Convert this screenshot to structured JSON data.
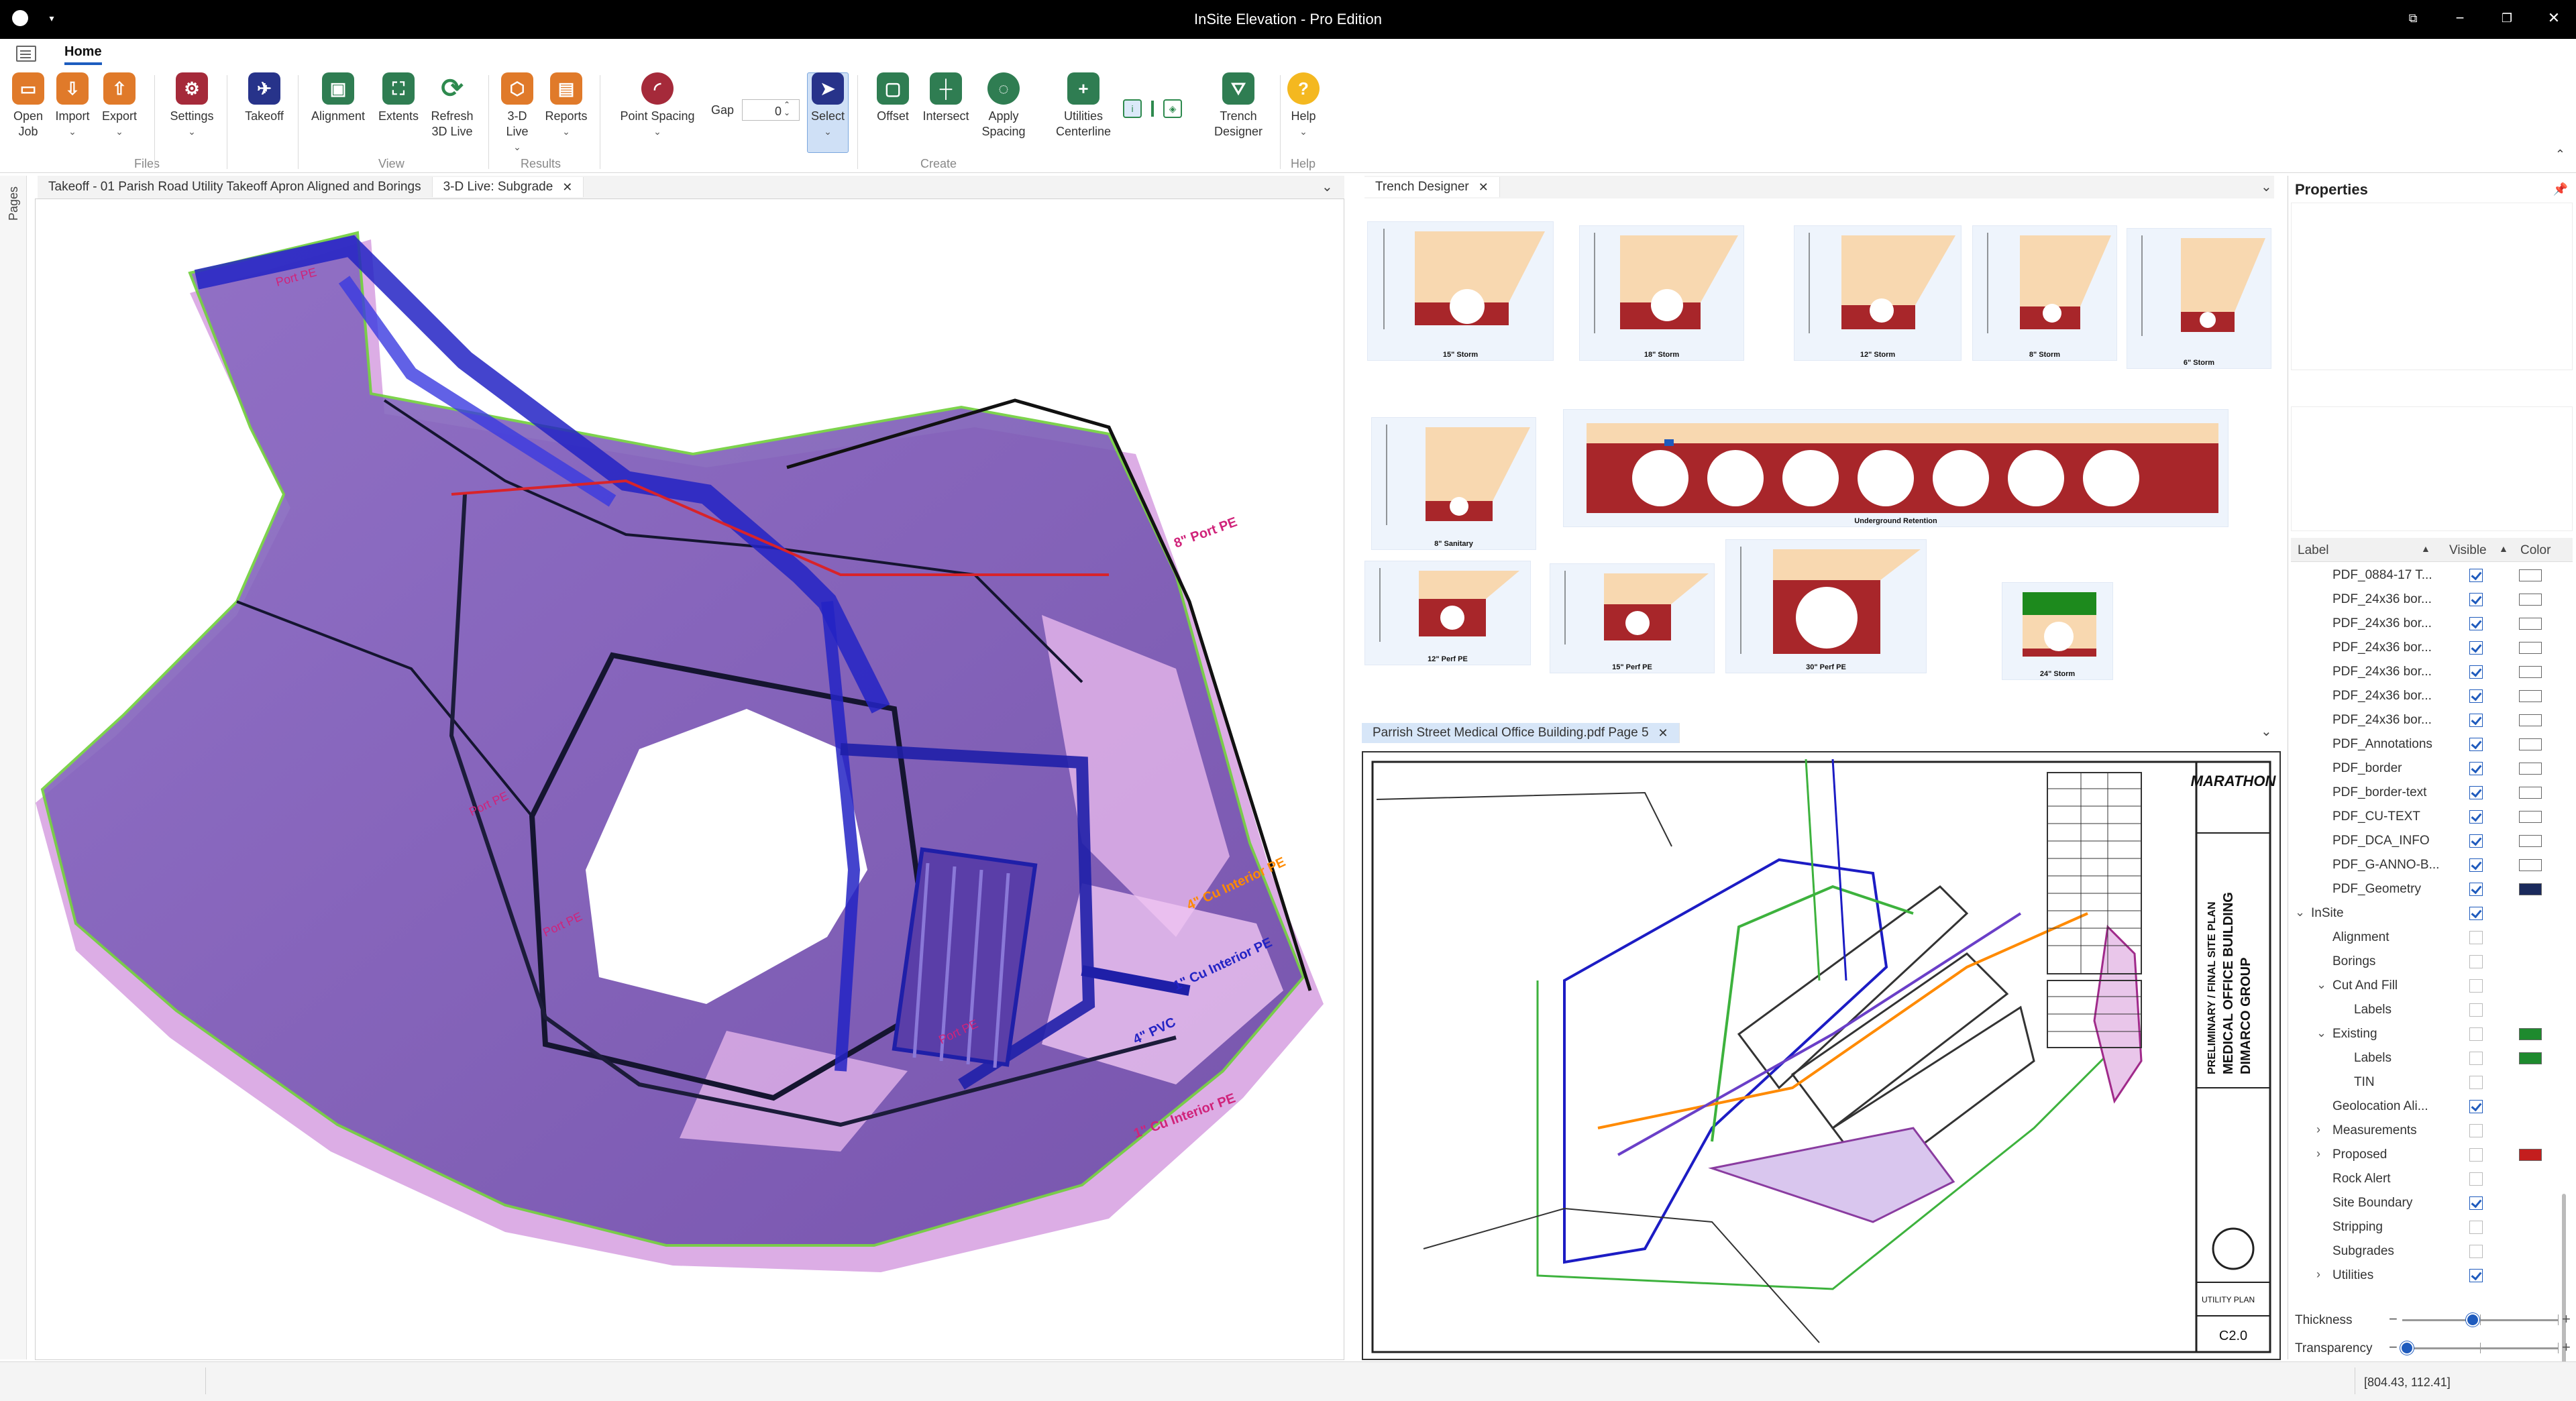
{
  "window": {
    "title": "InSite Elevation - Pro Edition"
  },
  "ribbon": {
    "active_tab": "Home",
    "buttons": {
      "open_job": "Open\nJob",
      "import": "Import",
      "export": "Export",
      "settings": "Settings",
      "takeoff": "Takeoff",
      "alignment": "Alignment",
      "extents": "Extents",
      "refresh_3d": "Refresh\n3D Live",
      "live_3d": "3-D\nLive",
      "reports": "Reports",
      "point_spacing": "Point Spacing",
      "select": "Select",
      "offset": "Offset",
      "intersect": "Intersect",
      "apply_spacing": "Apply\nSpacing",
      "utilities_centerline": "Utilities\nCenterline",
      "trench_designer": "Trench\nDesigner",
      "help": "Help"
    },
    "gap": {
      "label": "Gap",
      "value": "0"
    },
    "groups": [
      "Files",
      "View",
      "Results",
      "Create",
      "Help"
    ]
  },
  "rail": {
    "pages_label": "Pages"
  },
  "left_pane": {
    "tabs": [
      {
        "label": "Takeoff - 01 Parish Road Utility Takeoff Apron Aligned and Borings"
      },
      {
        "label": "3-D Live: Subgrade"
      }
    ],
    "labels": [
      "Port PE",
      "Port PE",
      "Port PE",
      "Port PE",
      "8\" Port PE",
      "1\" Cu Interior PE",
      "4\" Cu Interior PE",
      "4\" PVC",
      "1\" Cu Interior PE"
    ]
  },
  "trench_pane": {
    "tab": "Trench Designer",
    "cards": [
      "15\" Storm",
      "18\" Storm",
      "12\" Storm",
      "8\" Storm",
      "6\" Storm",
      "8\" Sanitary",
      "Underground Retention",
      "12\" Perf PE",
      "15\" Perf PE",
      "30\" Perf PE",
      "24\" Storm"
    ]
  },
  "pdf_pane": {
    "tab": "Parrish Street Medical Office Building.pdf Page 5",
    "sheet_title": "PRELIMINARY / FINAL SITE PLAN",
    "building": "MEDICAL OFFICE BUILDING",
    "owner": "DIMARCO GROUP",
    "sheet_name": "UTILITY PLAN",
    "sheet_no": "C2.0",
    "firm": "MARATHON"
  },
  "properties": {
    "title": "Properties",
    "columns": {
      "label": "Label",
      "visible": "Visible",
      "color": "Color"
    },
    "layers": [
      {
        "label": "PDF_0884-17 T...",
        "indent": 1,
        "visible": true,
        "color": "#ffffff"
      },
      {
        "label": "PDF_24x36 bor...",
        "indent": 1,
        "visible": true,
        "color": "#ffffff"
      },
      {
        "label": "PDF_24x36 bor...",
        "indent": 1,
        "visible": true,
        "color": "#ffffff"
      },
      {
        "label": "PDF_24x36 bor...",
        "indent": 1,
        "visible": true,
        "color": "#ffffff"
      },
      {
        "label": "PDF_24x36 bor...",
        "indent": 1,
        "visible": true,
        "color": "#ffffff"
      },
      {
        "label": "PDF_24x36 bor...",
        "indent": 1,
        "visible": true,
        "color": "#ffffff"
      },
      {
        "label": "PDF_24x36 bor...",
        "indent": 1,
        "visible": true,
        "color": "#ffffff"
      },
      {
        "label": "PDF_Annotations",
        "indent": 1,
        "visible": true,
        "color": "#ffffff"
      },
      {
        "label": "PDF_border",
        "indent": 1,
        "visible": true,
        "color": "#ffffff"
      },
      {
        "label": "PDF_border-text",
        "indent": 1,
        "visible": true,
        "color": "#ffffff"
      },
      {
        "label": "PDF_CU-TEXT",
        "indent": 1,
        "visible": true,
        "color": "#ffffff"
      },
      {
        "label": "PDF_DCA_INFO",
        "indent": 1,
        "visible": true,
        "color": "#ffffff"
      },
      {
        "label": "PDF_G-ANNO-B...",
        "indent": 1,
        "visible": true,
        "color": "#ffffff"
      },
      {
        "label": "PDF_Geometry",
        "indent": 1,
        "visible": true,
        "color": "#1a2a5c"
      },
      {
        "label": "InSite",
        "indent": 0,
        "expander": "open",
        "visible": true,
        "color": ""
      },
      {
        "label": "Alignment",
        "indent": 1,
        "visible": false,
        "color": ""
      },
      {
        "label": "Borings",
        "indent": 1,
        "visible": false,
        "color": ""
      },
      {
        "label": "Cut And Fill",
        "indent": 1,
        "expander": "open",
        "visible": false,
        "color": ""
      },
      {
        "label": "Labels",
        "indent": 2,
        "visible": false,
        "color": ""
      },
      {
        "label": "Existing",
        "indent": 1,
        "expander": "open",
        "visible": false,
        "color": "#1e8a2e"
      },
      {
        "label": "Labels",
        "indent": 2,
        "visible": false,
        "color": "#1e8a2e"
      },
      {
        "label": "TIN",
        "indent": 2,
        "visible": false,
        "color": ""
      },
      {
        "label": "Geolocation Ali...",
        "indent": 1,
        "visible": true,
        "color": ""
      },
      {
        "label": "Measurements",
        "indent": 1,
        "expander": "closed",
        "visible": false,
        "color": ""
      },
      {
        "label": "Proposed",
        "indent": 1,
        "expander": "closed",
        "visible": false,
        "color": "#c41e1e"
      },
      {
        "label": "Rock Alert",
        "indent": 1,
        "visible": false,
        "color": ""
      },
      {
        "label": "Site Boundary",
        "indent": 1,
        "visible": true,
        "color": ""
      },
      {
        "label": "Stripping",
        "indent": 1,
        "visible": false,
        "color": ""
      },
      {
        "label": "Subgrades",
        "indent": 1,
        "visible": false,
        "color": ""
      },
      {
        "label": "Utilities",
        "indent": 1,
        "expander": "closed",
        "visible": true,
        "color": ""
      }
    ],
    "thickness": {
      "label": "Thickness",
      "value": 0.15
    },
    "transparency": {
      "label": "Transparency",
      "value": 0.03
    }
  },
  "status": {
    "coords": "[804.43, 112.41]"
  }
}
